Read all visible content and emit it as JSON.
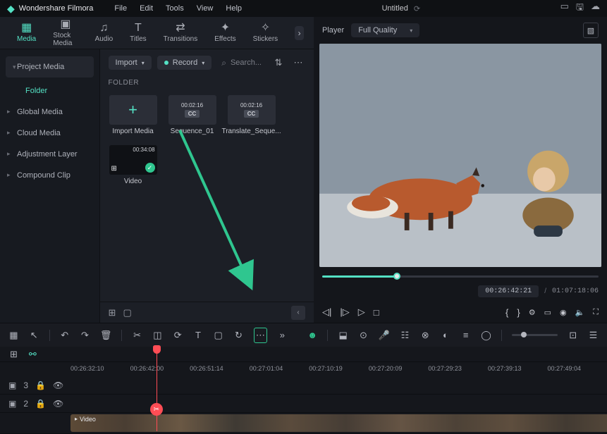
{
  "app": {
    "name": "Wondershare Filmora",
    "title": "Untitled"
  },
  "menu": [
    "File",
    "Edit",
    "Tools",
    "View",
    "Help"
  ],
  "tabs": [
    {
      "label": "Media",
      "active": true
    },
    {
      "label": "Stock Media"
    },
    {
      "label": "Audio"
    },
    {
      "label": "Titles"
    },
    {
      "label": "Transitions"
    },
    {
      "label": "Effects"
    },
    {
      "label": "Stickers"
    }
  ],
  "sidebar": {
    "head": "Project Media",
    "sub": "Folder",
    "items": [
      "Global Media",
      "Cloud Media",
      "Adjustment Layer",
      "Compound Clip"
    ]
  },
  "toolbar": {
    "import": "Import",
    "record": "Record",
    "search_placeholder": "Search..."
  },
  "section": "FOLDER",
  "grid": [
    {
      "label": "Import Media",
      "type": "import"
    },
    {
      "label": "Sequence_01",
      "type": "cc",
      "dur": "00:02:16"
    },
    {
      "label": "Translate_Seque...",
      "type": "cc",
      "dur": "00:02:16"
    },
    {
      "label": "Video",
      "type": "video",
      "dur": "00:34:08",
      "check": true
    }
  ],
  "preview": {
    "player": "Player",
    "quality": "Full Quality",
    "timecode": "00:26:42:21",
    "duration": "01:07:18:06"
  },
  "ruler": [
    "00:26:32:10",
    "00:26:42:00",
    "00:26:51:14",
    "00:27:01:04",
    "00:27:10:19",
    "00:27:20:09",
    "00:27:29:23",
    "00:27:39:13",
    "00:27:49:04"
  ],
  "clip": {
    "label": "Video"
  }
}
